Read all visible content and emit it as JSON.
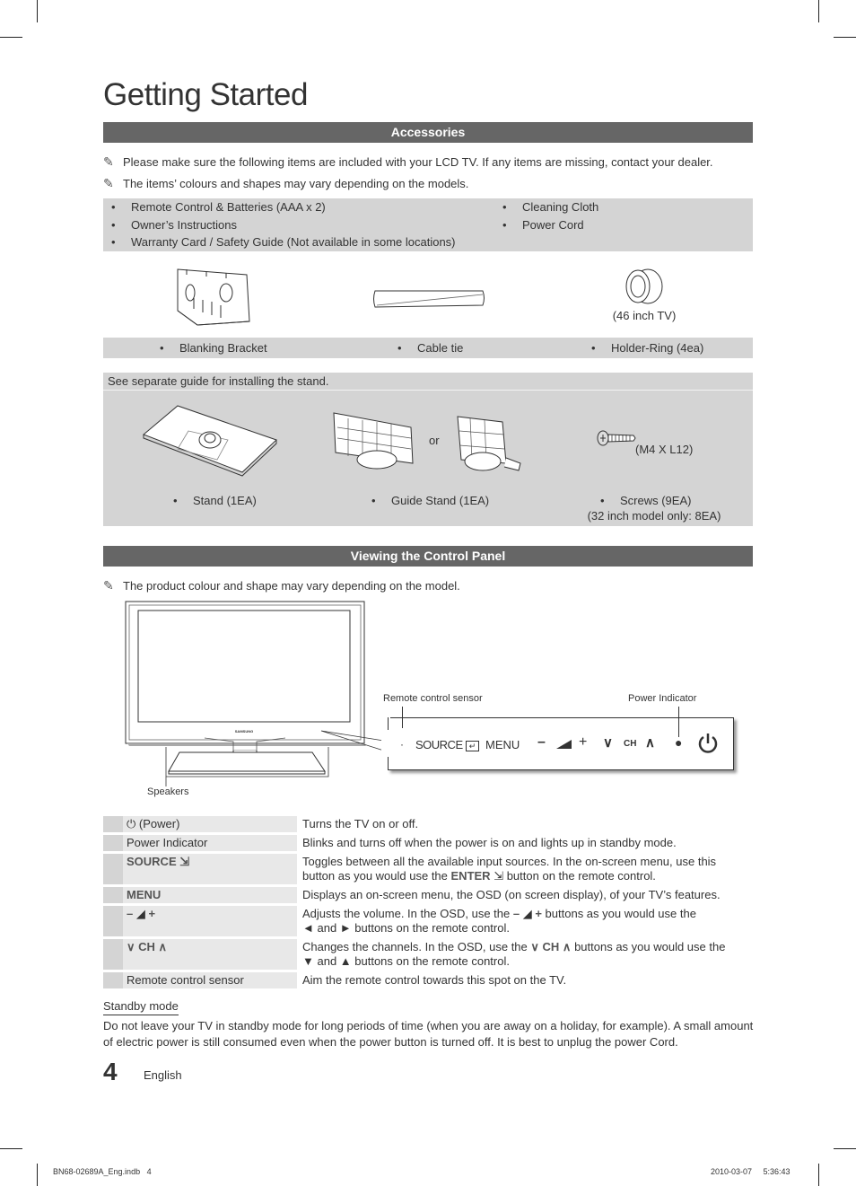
{
  "page": {
    "title": "Getting Started",
    "page_number": "4",
    "language": "English",
    "footer_file": "BN68-02689A_Eng.indb   4",
    "footer_timestamp": "2010-03-07     5:36:43"
  },
  "accessories": {
    "heading": "Accessories",
    "notes": [
      "Please make sure the following items are included with your LCD TV. If any items are missing, contact your dealer.",
      "The items’ colours and shapes may vary depending on the models."
    ],
    "included_left": [
      "Remote Control & Batteries (AAA x 2)",
      "Owner’s Instructions",
      "Warranty Card / Safety Guide (Not available in some locations)"
    ],
    "included_right": [
      "Cleaning Cloth",
      "Power Cord"
    ],
    "pictured": [
      {
        "label": "Blanking Bracket",
        "icon": "blanking-bracket-icon"
      },
      {
        "label": "Cable tie",
        "icon": "cable-tie-icon"
      },
      {
        "label": "Holder-Ring (4ea)",
        "icon": "holder-ring-icon",
        "caption": "(46 inch TV)"
      }
    ],
    "stand_note": "See separate guide for installing the stand.",
    "stand_items": [
      {
        "label": "Stand (1EA)",
        "icon": "stand-icon"
      },
      {
        "label": "Guide Stand (1EA)",
        "icon": "guide-stand-icon",
        "or": "or"
      },
      {
        "label": "Screws (9EA)",
        "icon": "screw-icon",
        "caption": "(M4 X L12)",
        "sub": "(32 inch model only: 8EA)"
      }
    ]
  },
  "control_panel": {
    "heading": "Viewing the Control Panel",
    "note": "The product colour and shape may vary depending on the model.",
    "callouts": {
      "remote_sensor": "Remote control sensor",
      "power_indicator": "Power Indicator",
      "speakers": "Speakers",
      "brand": "SAMSUNG"
    },
    "panel_buttons": {
      "source": "SOURCE",
      "menu": "MENU",
      "minus": "–",
      "plus": "+",
      "ch": "CH"
    },
    "table": [
      {
        "key": "(Power)",
        "desc": "Turns the TV on or off."
      },
      {
        "key": "Power Indicator",
        "desc": "Blinks and turns off when the power is on and lights up in standby mode."
      },
      {
        "key": "SOURCE",
        "desc_a": "Toggles between all the available input sources. In the on-screen menu, use this button as you would use the ",
        "desc_bold": "ENTER",
        "desc_b": " button on the remote control."
      },
      {
        "key": "MENU",
        "desc": "Displays an on-screen menu, the OSD (on screen display), of your TV’s features."
      },
      {
        "key_minus": "–",
        "key_plus": "+",
        "desc_a": "Adjusts the volume. In the OSD, use the ",
        "desc_b": " buttons as you would use the",
        "desc_c": "◄ and ► buttons on the remote control."
      },
      {
        "key_ch": "CH",
        "desc_a": "Changes the channels. In the OSD, use the ",
        "desc_ch": "CH",
        "desc_b": " buttons as you would use the",
        "desc_c": "▼ and ▲ buttons on the remote control."
      },
      {
        "key": "Remote control sensor",
        "desc": "Aim the remote control towards this spot on the TV."
      }
    ]
  },
  "standby": {
    "heading": "Standby mode",
    "text": "Do not leave your TV in standby mode for long periods of time (when you are away on a holiday, for example). A small amount of electric power is still consumed even when the power button is turned off. It is best to unplug the power Cord."
  }
}
